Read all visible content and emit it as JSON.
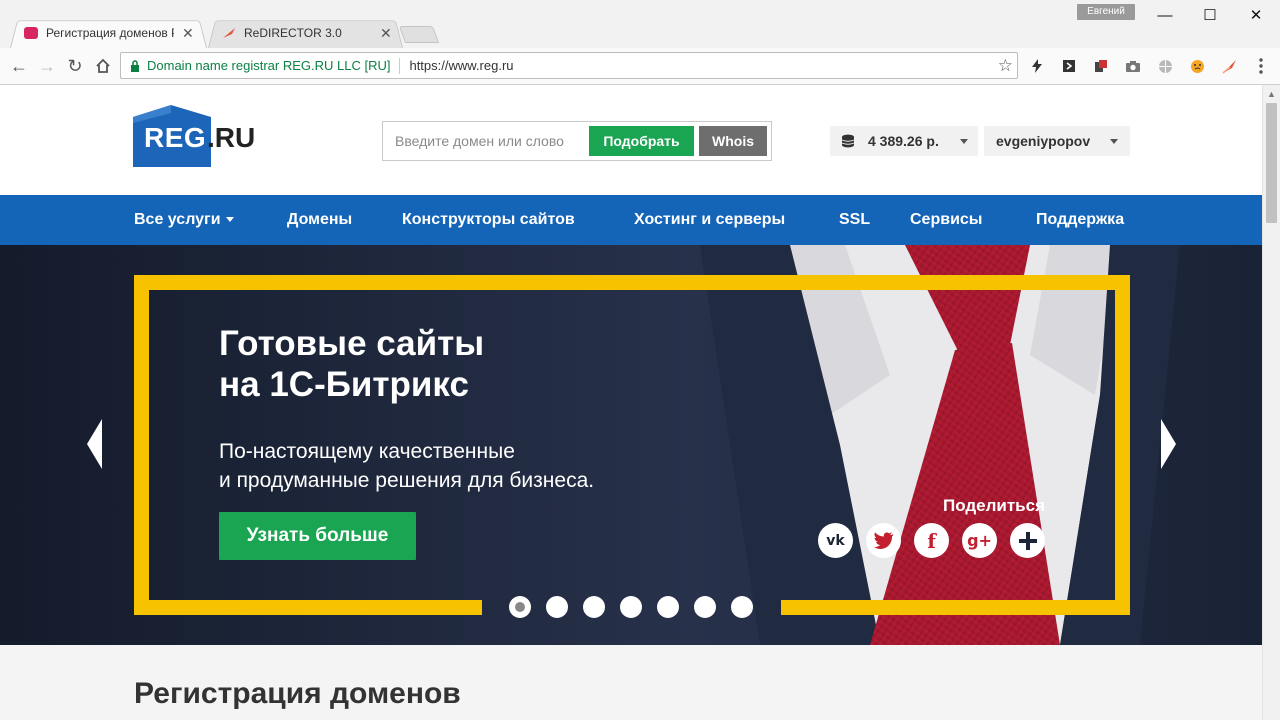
{
  "browser": {
    "tabs": [
      {
        "title": "Регистрация доменов Р",
        "active": true
      },
      {
        "title": "ReDIRECTOR 3.0",
        "active": false
      }
    ],
    "profile_name": "Евгений",
    "omnibox": {
      "secure_label": "Domain name registrar REG.RU LLC [RU]",
      "url": "https://www.reg.ru"
    },
    "window_controls": {
      "minimize": "—",
      "maximize": "☐",
      "close": "✕"
    }
  },
  "header": {
    "logo_main": "REG",
    "logo_suffix": ".RU",
    "search": {
      "placeholder": "Введите домен или слово",
      "value": "",
      "pick_label": "Подобрать",
      "whois_label": "Whois"
    },
    "balance": "4 389.26 р.",
    "account": "evgeniypopov"
  },
  "nav": {
    "items": [
      {
        "label": "Все услуги"
      },
      {
        "label": "Домены"
      },
      {
        "label": "Конструкторы сайтов"
      },
      {
        "label": "Хостинг и серверы"
      },
      {
        "label": "SSL"
      },
      {
        "label": "Сервисы"
      },
      {
        "label": "Поддержка"
      }
    ]
  },
  "banner": {
    "title_line1": "Готовые сайты",
    "title_line2": "на 1С-Битрикс",
    "subtitle_line1": "По-настоящему качественные",
    "subtitle_line2": "и продуманные решения для бизнеса.",
    "cta_label": "Узнать больше",
    "share_label": "Поделиться",
    "social": [
      "vk-icon",
      "twitter-icon",
      "facebook-icon",
      "google-plus-icon",
      "plus-icon"
    ],
    "slides_count": 7,
    "active_slide": 1
  },
  "section": {
    "title": "Регистрация доменов"
  },
  "colors": {
    "nav_blue": "#1464b8",
    "brand_green": "#1aa553",
    "frame_yellow": "#f7c300",
    "logo_blue": "#1d65b8"
  }
}
